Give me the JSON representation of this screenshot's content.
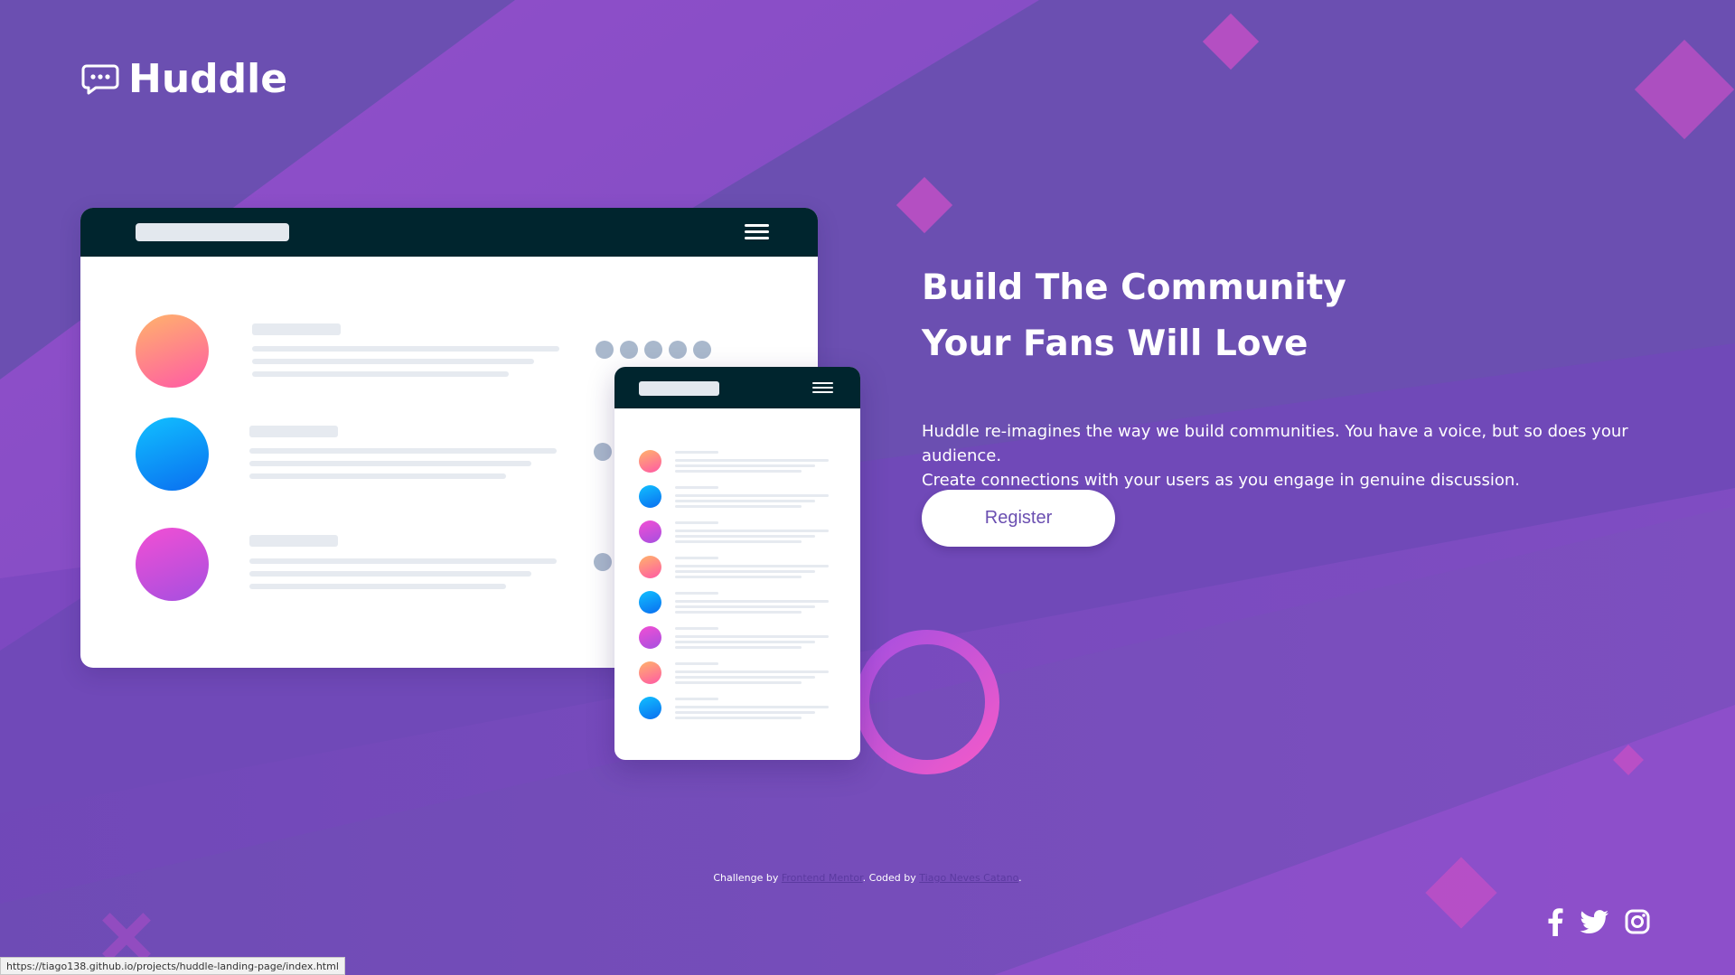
{
  "brand": {
    "name": "Huddle",
    "logo_icon": "chat-bubble-icon"
  },
  "hero": {
    "title_line1": "Build The Community",
    "title_line2": "Your Fans Will Love",
    "description_line1": "Huddle re-imagines the way we build communities. You have a voice, but so does your audience.",
    "description_line2": "Create connections with your users as you engage in genuine discussion."
  },
  "cta": {
    "register_label": "Register"
  },
  "footer": {
    "challenge_prefix": "Challenge by ",
    "challenge_link": "Frontend Mentor",
    "coded_prefix": ". Coded by ",
    "coded_link": "Tiago Neves Catano",
    "suffix": "."
  },
  "social": [
    {
      "icon": "facebook-icon"
    },
    {
      "icon": "twitter-icon"
    },
    {
      "icon": "instagram-icon"
    }
  ],
  "status_bar": {
    "url": "https://tiago138.github.io/projects/huddle-landing-page/index.html"
  },
  "colors": {
    "background": "#6b4fb1",
    "accent_pink": "#d44fd4",
    "mock_header": "#00252e",
    "text": "#ffffff"
  }
}
